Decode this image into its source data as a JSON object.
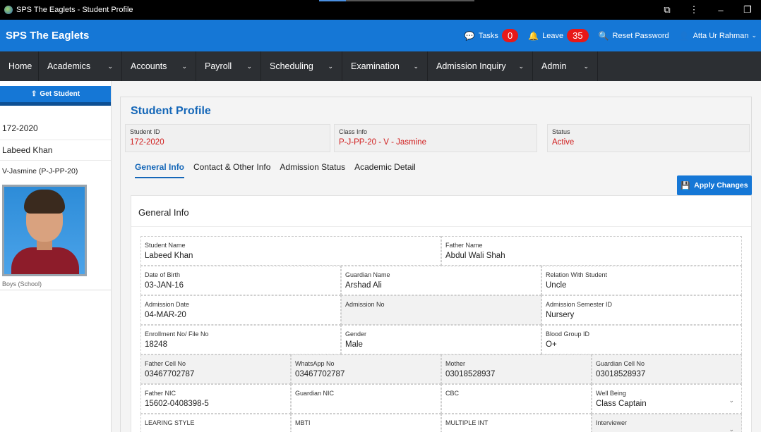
{
  "window": {
    "title": "SPS The Eaglets - Student Profile",
    "controls": {
      "extensions": "⧉",
      "menu": "⋮",
      "minimize": "–",
      "restore": "❐"
    }
  },
  "appbar": {
    "brand": "SPS The Eaglets",
    "tasks_label": "Tasks",
    "tasks_count": "0",
    "leave_label": "Leave",
    "leave_count": "35",
    "reset_password": "Reset Password",
    "user": "Atta Ur Rahman"
  },
  "nav": {
    "items": [
      {
        "label": "Home",
        "chevron": ""
      },
      {
        "label": "Academics",
        "chevron": "⌄"
      },
      {
        "label": "Accounts",
        "chevron": "⌄"
      },
      {
        "label": "Payroll",
        "chevron": "⌄"
      },
      {
        "label": "Scheduling",
        "chevron": "⌄"
      },
      {
        "label": "Examination",
        "chevron": "⌄"
      },
      {
        "label": "Admission Inquiry",
        "chevron": "⌄"
      },
      {
        "label": "Admin",
        "chevron": "⌄"
      }
    ]
  },
  "sidebar": {
    "get_student": "Get Student",
    "student_id": "172-2020",
    "student_name": "Labeed Khan",
    "class": "V-Jasmine (P-J-PP-20)",
    "campus": "Boys (School)"
  },
  "profile": {
    "title": "Student Profile",
    "summary": [
      {
        "label": "Student ID",
        "value": "172-2020"
      },
      {
        "label": "Class Info",
        "value": "P-J-PP-20 - V - Jasmine"
      },
      {
        "label": "Status",
        "value": "Active"
      }
    ],
    "tabs": [
      "General Info",
      "Contact & Other Info",
      "Admission Status",
      "Academic Detail"
    ],
    "apply_label": "Apply Changes",
    "section_title": "General Info"
  },
  "fields": {
    "student_name": {
      "label": "Student Name",
      "value": "Labeed Khan"
    },
    "father_name": {
      "label": "Father Name",
      "value": "Abdul Wali Shah"
    },
    "dob": {
      "label": "Date of Birth",
      "value": "03-JAN-16"
    },
    "guardian_name": {
      "label": "Guardian Name",
      "value": "Arshad Ali"
    },
    "relation": {
      "label": "Relation With Student",
      "value": "Uncle"
    },
    "admission_date": {
      "label": "Admission Date",
      "value": "04-MAR-20"
    },
    "admission_no": {
      "label": "Admission No",
      "value": ""
    },
    "admission_semester": {
      "label": "Admission Semester ID",
      "value": "Nursery"
    },
    "enrollment_no": {
      "label": "Enrollment No/ File No",
      "value": "18248"
    },
    "gender": {
      "label": "Gender",
      "value": "Male"
    },
    "blood_group": {
      "label": "Blood Group ID",
      "value": "O+"
    },
    "father_cell": {
      "label": "Father Cell No",
      "value": "03467702787"
    },
    "whatsapp": {
      "label": "WhatsApp No",
      "value": "03467702787"
    },
    "mother": {
      "label": "Mother",
      "value": "03018528937"
    },
    "guardian_cell": {
      "label": "Guardian Cell No",
      "value": "03018528937"
    },
    "father_nic": {
      "label": "Father NIC",
      "value": "15602-0408398-5"
    },
    "guardian_nic": {
      "label": "Guardian NIC",
      "value": ""
    },
    "cbc": {
      "label": "CBC",
      "value": ""
    },
    "well_being": {
      "label": "Well Being",
      "value": "Class Captain"
    },
    "learning_style": {
      "label": "LEARING STYLE",
      "value": ""
    },
    "mbti": {
      "label": "MBTI",
      "value": ""
    },
    "multiple_int": {
      "label": "MULTIPLE INT",
      "value": ""
    },
    "interviewer": {
      "label": "Interviewer",
      "value": ""
    }
  }
}
